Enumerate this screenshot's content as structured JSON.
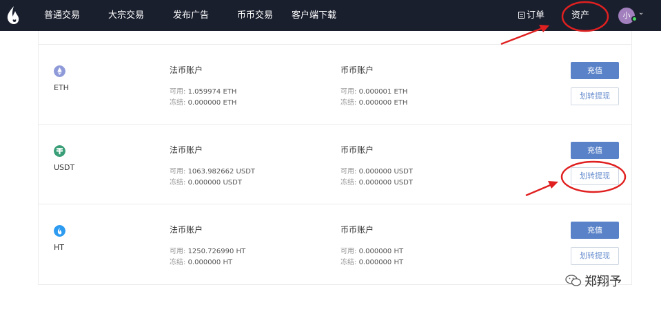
{
  "nav": {
    "items": [
      "普通交易",
      "大宗交易",
      "发布广告",
      "币币交易",
      "客户端下载"
    ],
    "orders_label": "订单",
    "assets_label": "资产",
    "avatar_text": "小"
  },
  "accounts": [
    {
      "coin": "ETH",
      "color": "#8f9bd9",
      "fiat": {
        "title": "法币账户",
        "available_label": "可用:",
        "available": "1.059974 ETH",
        "frozen_label": "冻结:",
        "frozen": "0.000000 ETH"
      },
      "spot": {
        "title": "币币账户",
        "available_label": "可用:",
        "available": "0.000001 ETH",
        "frozen_label": "冻结:",
        "frozen": "0.000000 ETH"
      },
      "deposit_label": "充值",
      "transfer_label": "划转提现"
    },
    {
      "coin": "USDT",
      "color": "#3a9f78",
      "fiat": {
        "title": "法币账户",
        "available_label": "可用:",
        "available": "1063.982662 USDT",
        "frozen_label": "冻结:",
        "frozen": "0.000000 USDT"
      },
      "spot": {
        "title": "币币账户",
        "available_label": "可用:",
        "available": "0.000000 USDT",
        "frozen_label": "冻结:",
        "frozen": "0.000000 USDT"
      },
      "deposit_label": "充值",
      "transfer_label": "划转提现"
    },
    {
      "coin": "HT",
      "color": "#2d9bf0",
      "fiat": {
        "title": "法币账户",
        "available_label": "可用:",
        "available": "1250.726990 HT",
        "frozen_label": "冻结:",
        "frozen": "0.000000 HT"
      },
      "spot": {
        "title": "币币账户",
        "available_label": "可用:",
        "available": "0.000000 HT",
        "frozen_label": "冻结:",
        "frozen": "0.000000 HT"
      },
      "deposit_label": "充值",
      "transfer_label": "划转提现"
    }
  ],
  "watermark": "郑翔予",
  "colors": {
    "nav_bg": "#1a1f2e",
    "primary": "#5a82c8",
    "annotation": "#e02020"
  }
}
